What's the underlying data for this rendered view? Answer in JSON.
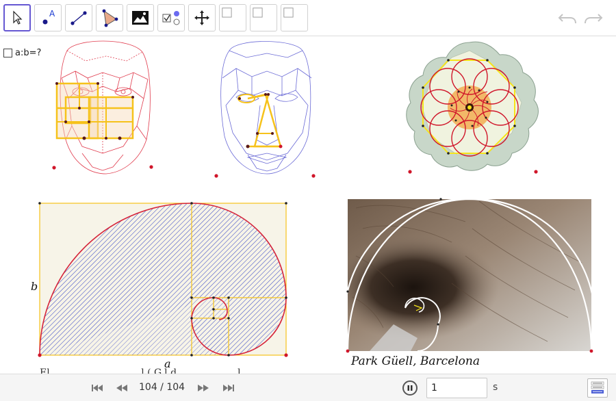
{
  "toolbar": {
    "tools": [
      {
        "name": "move-tool",
        "icon": "pointer-icon"
      },
      {
        "name": "point-tool",
        "icon": "point-icon",
        "label": "A"
      },
      {
        "name": "segment-tool",
        "icon": "segment-icon"
      },
      {
        "name": "polygon-tool",
        "icon": "polygon-icon"
      },
      {
        "name": "image-tool",
        "icon": "image-icon"
      },
      {
        "name": "checkbox-tool",
        "icon": "checkbox-icon"
      },
      {
        "name": "move-graphics-tool",
        "icon": "move-arrows-icon"
      },
      {
        "name": "custom-tool-1",
        "icon": "blank-tool-icon"
      },
      {
        "name": "custom-tool-2",
        "icon": "blank-tool-icon"
      },
      {
        "name": "custom-tool-3",
        "icon": "blank-tool-icon"
      }
    ],
    "undo_icon": "undo-icon",
    "redo_icon": "redo-icon"
  },
  "canvas": {
    "checkbox_label": "a:b=?",
    "label_a": "a",
    "label_b": "b",
    "photo_caption": "Park Güell, Barcelona",
    "cut_text": "El ............. ........ ......l ( G.l.d ........... .......l .."
  },
  "playback": {
    "counter": "104 / 104",
    "speed_value": "1",
    "speed_unit": "s"
  },
  "colors": {
    "accent": "#6557d2",
    "golden_line": "#f6c21b",
    "spiral_red": "#d6243a",
    "hatch_blue": "#4a56c9",
    "rect_fill": "#f7f4e8"
  }
}
